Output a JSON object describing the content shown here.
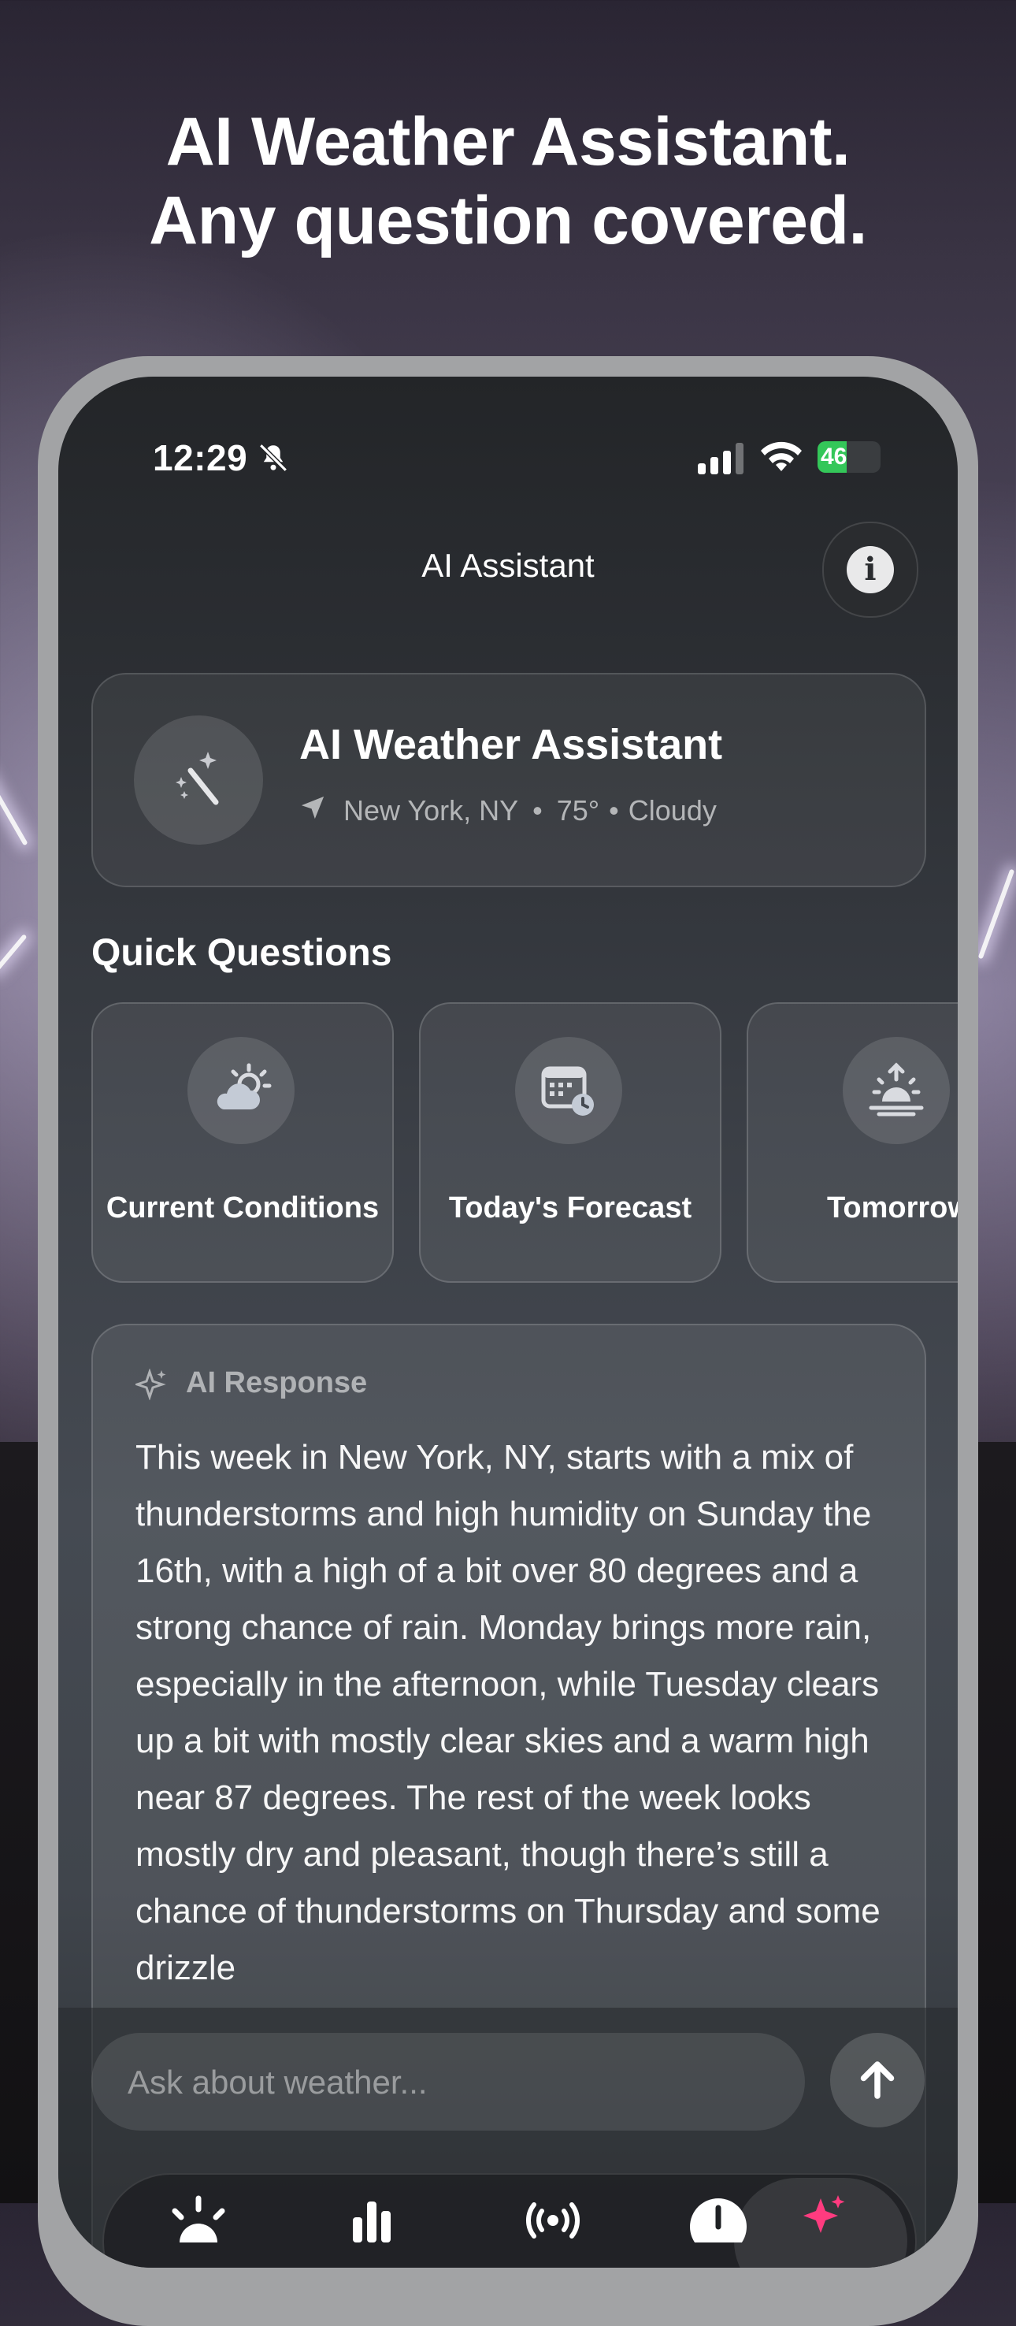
{
  "headline": {
    "line1": "AI Weather Assistant.",
    "line2": "Any question covered."
  },
  "status_bar": {
    "time": "12:29",
    "battery": "46",
    "battery_level": 0.46
  },
  "nav": {
    "title": "AI Assistant",
    "info_icon": "info-icon"
  },
  "assistant_card": {
    "title": "AI Weather Assistant",
    "location": "New York, NY",
    "separator": "•",
    "temperature": "75°",
    "dot": "•",
    "condition": "Cloudy"
  },
  "quick_questions": {
    "title": "Quick Questions",
    "items": [
      {
        "label": "Current Conditions",
        "icon": "cloud-sun-icon"
      },
      {
        "label": "Today's Forecast",
        "icon": "calendar-clock-icon"
      },
      {
        "label": "Tomorrow",
        "icon": "sunrise-icon"
      }
    ]
  },
  "response": {
    "label": "AI Response",
    "text": "This week in New York, NY, starts with a mix of thunderstorms and high humidity on Sunday the 16th, with a high of a bit over 80 degrees and a strong chance of rain. Monday brings more rain, especially in the afternoon, while Tuesday clears up a bit with mostly clear skies and a warm high near 87 degrees. The rest of the week looks mostly dry and pleasant, though there’s still a chance of thunderstorms on Thursday and some drizzle"
  },
  "input": {
    "placeholder": "Ask about weather..."
  },
  "tabbar": {
    "tabs": [
      "sun-icon",
      "chart-icon",
      "radar-icon",
      "clock-icon",
      "sparkles-icon"
    ],
    "active": "sparkles-icon"
  },
  "colors": {
    "battery": "#34c759",
    "accent_pink": "#ff3b7f"
  }
}
